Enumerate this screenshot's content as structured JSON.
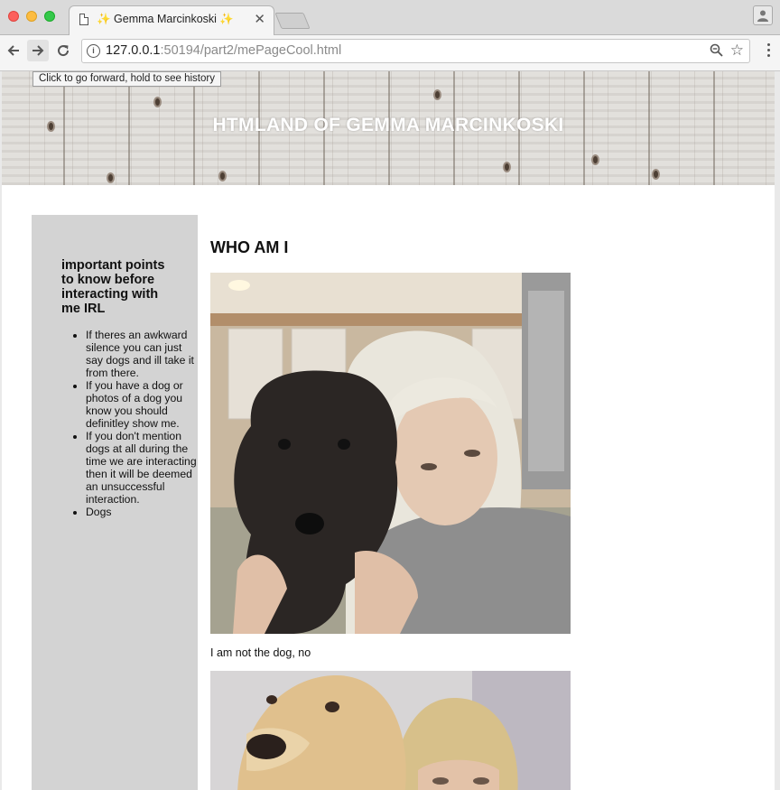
{
  "browser": {
    "tab_title": "✨ Gemma Marcinkoski ✨",
    "url_host": "127.0.0.1",
    "url_rest": ":50194/part2/mePageCool.html",
    "tooltip": "Click to go forward, hold to see history"
  },
  "header": {
    "title": "HTMLAND OF GEMMA MARCINKOSKI"
  },
  "sidebar": {
    "heading": "important points to know before interacting with me IRL",
    "items": [
      "If theres an awkward silence you can just say dogs and ill take it from there.",
      "If you have a dog or photos of a dog you know you should definitley show me.",
      "If you don't mention dogs at all during the time we are interacting then it will be deemed an unsuccessful interaction.",
      "Dogs"
    ]
  },
  "main": {
    "heading": "WHO AM I",
    "caption": "I am not the dog, no"
  },
  "colors": {
    "sidebar_bg": "#d3d3d3",
    "header_text": "#ffffff"
  }
}
